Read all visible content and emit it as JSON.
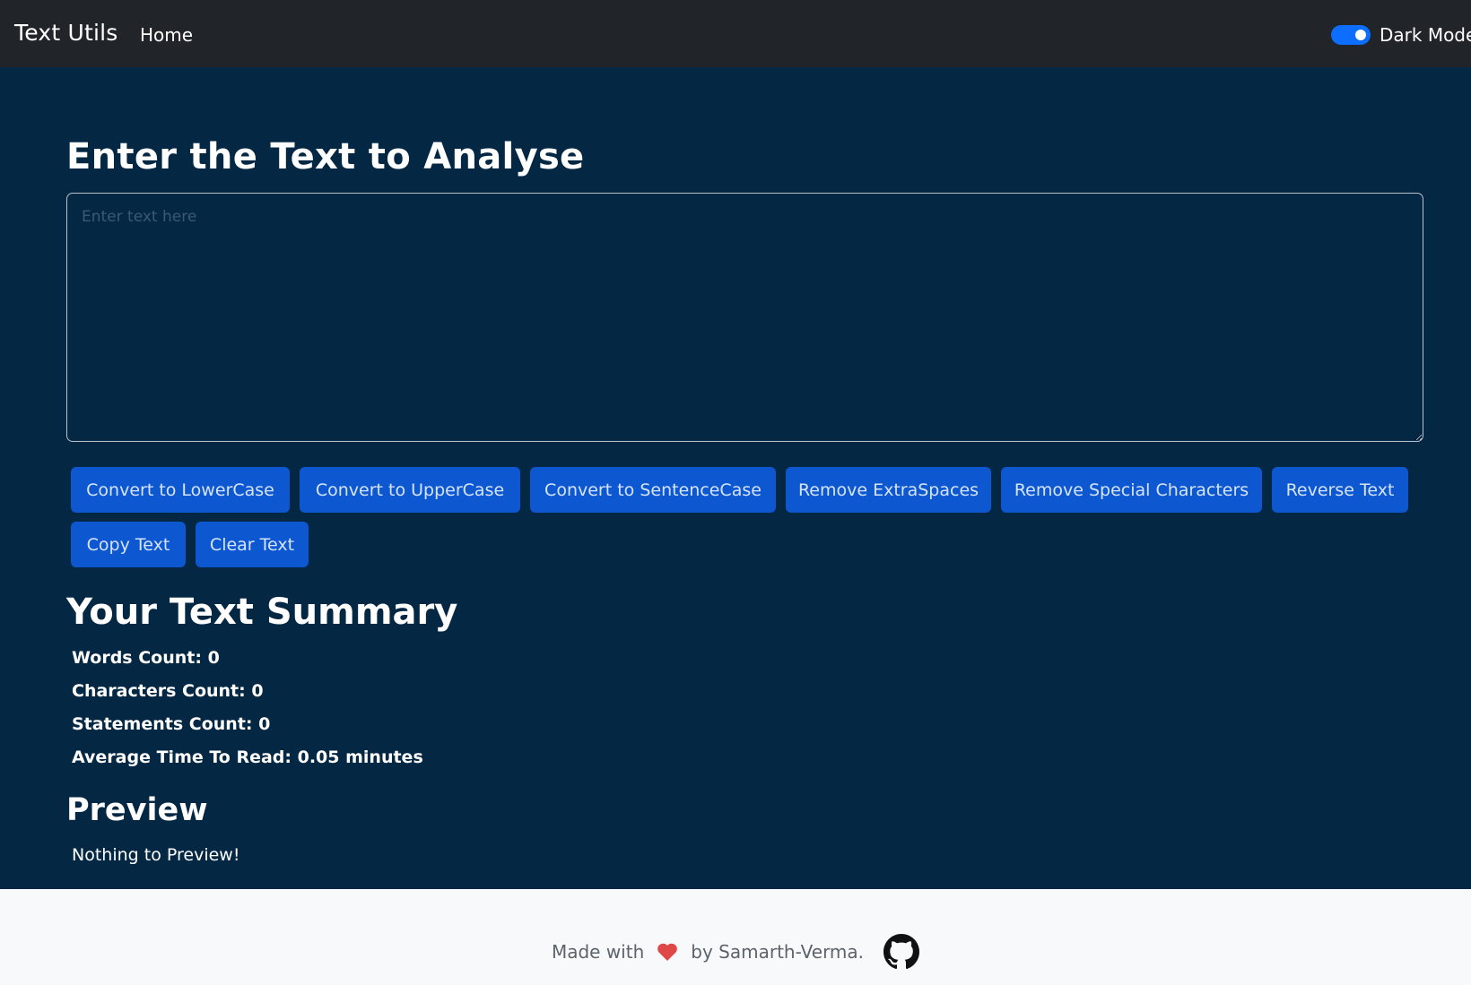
{
  "navbar": {
    "brand": "Text Utils",
    "home_link": "Home",
    "dark_mode_label": "Dark Mode",
    "dark_mode_enabled": true
  },
  "main": {
    "heading": "Enter the Text to Analyse",
    "textarea": {
      "value": "",
      "placeholder": "Enter text here"
    },
    "buttons": {
      "lowercase": "Convert to LowerCase",
      "uppercase": "Convert to UpperCase",
      "sentencecase": "Convert to SentenceCase",
      "extraspaces": "Remove ExtraSpaces",
      "specialchars": "Remove Special Characters",
      "reverse": "Reverse Text",
      "copy": "Copy Text",
      "clear": "Clear Text"
    }
  },
  "summary": {
    "title": "Your Text Summary",
    "words": "Words Count: 0",
    "characters": "Characters Count: 0",
    "statements": "Statements Count: 0",
    "read_time": "Average Time To Read: 0.05 minutes"
  },
  "preview": {
    "title": "Preview",
    "text": "Nothing to Preview!"
  },
  "footer": {
    "made_with": "Made with",
    "by": "by Samarth-Verma."
  },
  "colors": {
    "background": "#042743",
    "navbar": "#212529",
    "button": "#0d57d1",
    "toggle": "#0d6efd",
    "footer": "#f8f9fa",
    "heart": "#e04848"
  },
  "icons": [
    "heart-icon",
    "github-icon"
  ]
}
